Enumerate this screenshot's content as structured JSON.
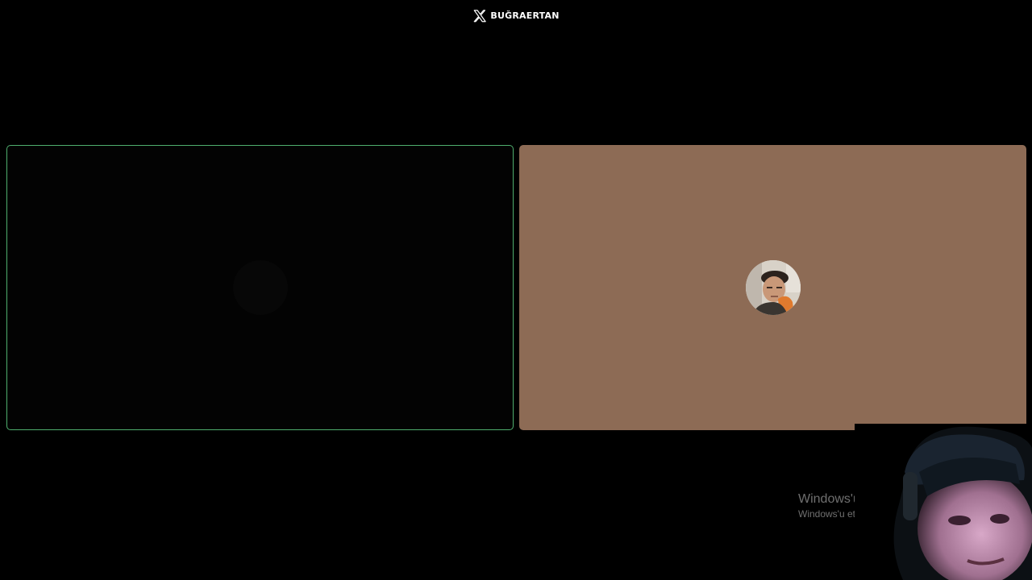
{
  "brand": {
    "icon": "x-logo-icon",
    "text": "BUĞRAERTAN",
    "color": "#ffffff"
  },
  "tiles": {
    "left": {
      "active": true,
      "border_color": "#4fae6e",
      "background": "#030303"
    },
    "right": {
      "background": "#8d6b55",
      "avatar_icon": "user-avatar-photo"
    }
  },
  "watermark": {
    "title": "Windows'u Etkin",
    "subtitle": "Windows'u etkinleştirm"
  },
  "webcam": {
    "icon": "webcam-overlay-photo"
  }
}
